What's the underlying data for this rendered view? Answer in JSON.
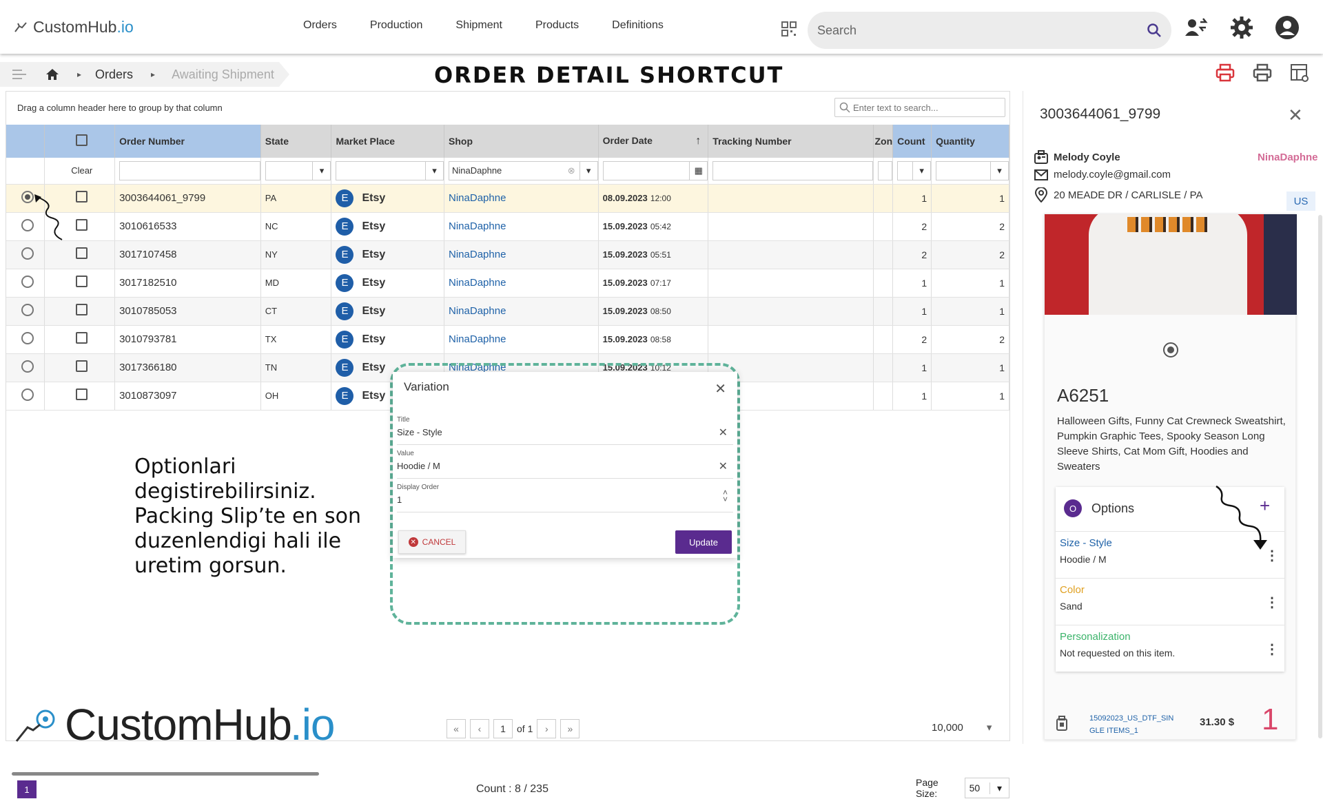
{
  "header": {
    "logo_main": "CustomHub",
    "logo_suffix": ".io",
    "nav": [
      "Orders",
      "Production",
      "Shipment",
      "Products",
      "Definitions"
    ],
    "search_placeholder": "Search"
  },
  "breadcrumb": {
    "items": [
      "Orders",
      "Awaiting Shipment"
    ]
  },
  "page_heading": "ORDER DETAIL SHORTCUT",
  "grid": {
    "group_hint": "Drag a column header here to group by that column",
    "search_placeholder": "Enter text to search...",
    "columns": [
      "Order Number",
      "State",
      "Market Place",
      "Shop",
      "Order Date",
      "Tracking Number",
      "Zon",
      "Count",
      "Quantity"
    ],
    "filter_clear": "Clear",
    "filter_shop": "NinaDaphne",
    "rows": [
      {
        "order": "3003644061_9799",
        "state": "PA",
        "market": "Etsy",
        "shop": "NinaDaphne",
        "date": "08.09.2023",
        "time": "12:00",
        "count": "1",
        "quantity": "1"
      },
      {
        "order": "3010616533",
        "state": "NC",
        "market": "Etsy",
        "shop": "NinaDaphne",
        "date": "15.09.2023",
        "time": "05:42",
        "count": "2",
        "quantity": "2"
      },
      {
        "order": "3017107458",
        "state": "NY",
        "market": "Etsy",
        "shop": "NinaDaphne",
        "date": "15.09.2023",
        "time": "05:51",
        "count": "2",
        "quantity": "2"
      },
      {
        "order": "3017182510",
        "state": "MD",
        "market": "Etsy",
        "shop": "NinaDaphne",
        "date": "15.09.2023",
        "time": "07:17",
        "count": "1",
        "quantity": "1"
      },
      {
        "order": "3010785053",
        "state": "CT",
        "market": "Etsy",
        "shop": "NinaDaphne",
        "date": "15.09.2023",
        "time": "08:50",
        "count": "1",
        "quantity": "1"
      },
      {
        "order": "3010793781",
        "state": "TX",
        "market": "Etsy",
        "shop": "NinaDaphne",
        "date": "15.09.2023",
        "time": "08:58",
        "count": "2",
        "quantity": "2"
      },
      {
        "order": "3017366180",
        "state": "TN",
        "market": "Etsy",
        "shop": "NinaDaphne",
        "date": "15.09.2023",
        "time": "10:12",
        "count": "1",
        "quantity": "1"
      },
      {
        "order": "3010873097",
        "state": "OH",
        "market": "Etsy",
        "shop": "",
        "date": "",
        "time": "",
        "count": "1",
        "quantity": "1"
      }
    ],
    "count_label": "Count : 8 / 235",
    "page_size_label": "Page Size:",
    "page_size": "50",
    "page_badge": "1",
    "pager_page": "1",
    "pager_of": "of 1",
    "limit_value": "10,000"
  },
  "note": {
    "lines": [
      "Optionlari",
      "degistirebilirsiniz.",
      "Packing Slip’te en son",
      "duzenlendigi hali ile",
      "uretim gorsun."
    ]
  },
  "dialog": {
    "title": "Variation",
    "title_label": "Title",
    "title_value": "Size - Style",
    "value_label": "Value",
    "value_value": "Hoodie / M",
    "order_label": "Display Order",
    "order_value": "1",
    "cancel_label": "CANCEL",
    "update_label": "Update"
  },
  "detail": {
    "order_id": "3003644061_9799",
    "customer": "Melody Coyle",
    "shop": "NinaDaphne",
    "email": "melody.coyle@gmail.com",
    "address": "20 MEADE DR / CARLISLE / PA",
    "country": "US",
    "sku": "A6251",
    "description": "Halloween Gifts, Funny Cat Crewneck Sweatshirt, Pumpkin Graphic Tees, Spooky Season Long Sleeve Shirts, Cat Mom Gift, Hoodies and Sweaters",
    "options_title": "Options",
    "options": [
      {
        "name": "Size - Style",
        "value": "Hoodie / M",
        "color": "#1f62a8"
      },
      {
        "name": "Color",
        "value": "Sand",
        "color": "#e0a020"
      },
      {
        "name": "Personalization",
        "value": "Not requested on this item.",
        "color": "#3bb36a"
      }
    ],
    "item_code_1": "15092023_US_DTF_SIN",
    "item_code_2": "GLE ITEMS_1",
    "item_price": "31.30 $",
    "item_qty": "1"
  },
  "colors": {
    "accent": "#5a2b8f",
    "link": "#1f62a8",
    "shop_pink": "#d36b96",
    "dash": "#5fb39a"
  }
}
